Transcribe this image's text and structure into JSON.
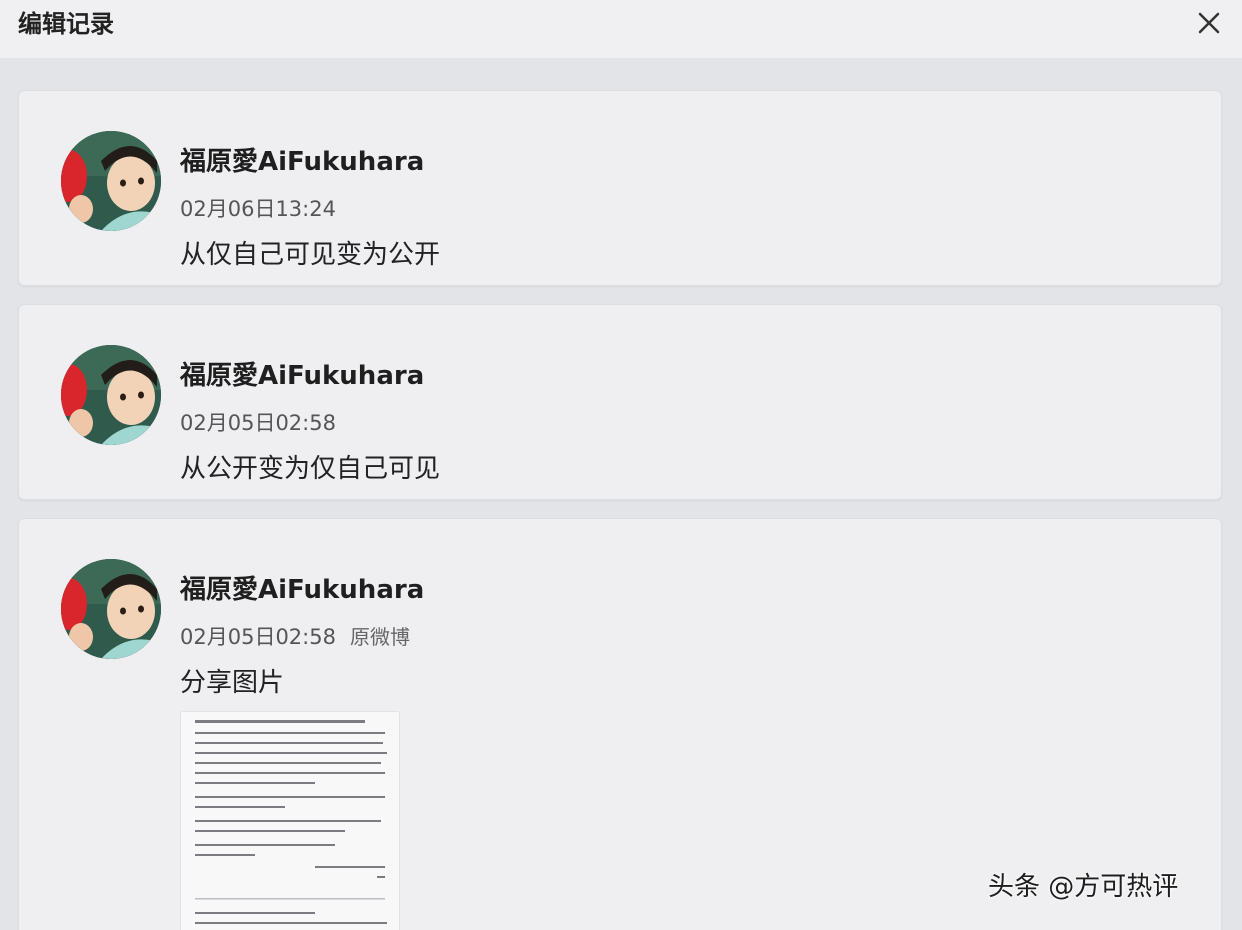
{
  "dialog": {
    "title": "编辑记录",
    "close_icon": "close-icon"
  },
  "records": [
    {
      "author": "福原愛AiFukuhara",
      "time": "02月06日13:24",
      "text": "从仅自己可见变为公开"
    },
    {
      "author": "福原愛AiFukuhara",
      "time": "02月05日02:58",
      "text": "从公开变为仅自己可见"
    },
    {
      "author": "福原愛AiFukuhara",
      "time": "02月05日02:58",
      "original_link": "原微博",
      "text": "分享图片",
      "attachment": "shared-document-image"
    }
  ],
  "watermark": "头条 @方可热评"
}
